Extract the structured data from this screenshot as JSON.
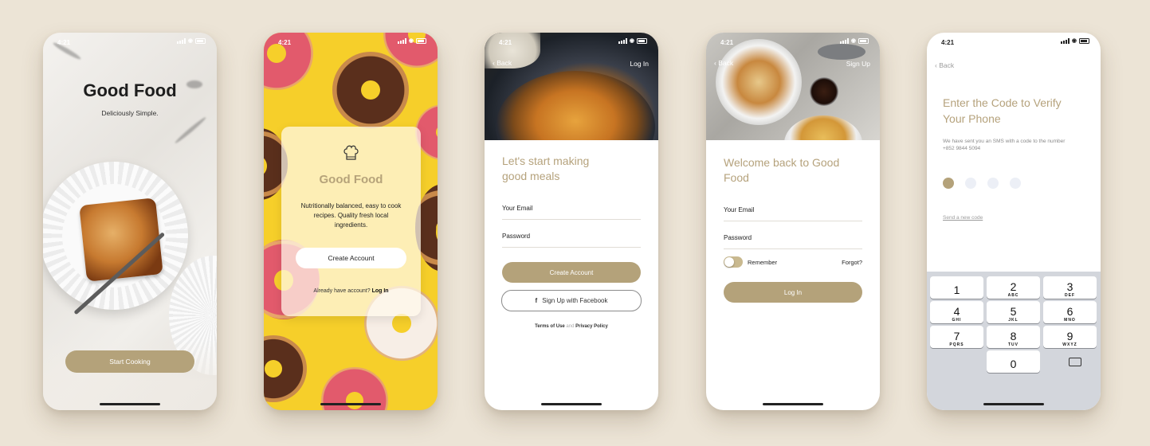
{
  "status": {
    "time": "4:21"
  },
  "screen1": {
    "title": "Good Food",
    "subtitle": "Deliciously Simple.",
    "cta": "Start Cooking"
  },
  "screen2": {
    "icon": "chef-hat-icon",
    "title": "Good Food",
    "description": "Nutritionally balanced, easy to cook recipes. Quality fresh local ingredients.",
    "create_account": "Create Account",
    "login_prompt": "Already have account?",
    "login_link": "Log In"
  },
  "screen3": {
    "back": "Back",
    "top_right": "Log In",
    "heading": "Let's start making good meals",
    "email_label": "Your Email",
    "password_label": "Password",
    "create_account": "Create Account",
    "facebook": "Sign Up with Facebook",
    "terms": "Terms of Use",
    "and": "and",
    "privacy": "Privacy Policy"
  },
  "screen4": {
    "back": "Back",
    "top_right": "Sign Up",
    "heading": "Welcome back to Good Food",
    "email_label": "Your Email",
    "password_label": "Password",
    "remember": "Remember",
    "forgot": "Forgot?",
    "login": "Log In"
  },
  "screen5": {
    "back": "Back",
    "heading": "Enter the Code to Verify Your Phone",
    "description": "We have sent you an SMS with a code to the number +852 9844 5094",
    "code_digits_filled": 1,
    "code_length": 4,
    "resend": "Send a new code",
    "keys": [
      {
        "num": "1",
        "letters": ""
      },
      {
        "num": "2",
        "letters": "ABC"
      },
      {
        "num": "3",
        "letters": "DEF"
      },
      {
        "num": "4",
        "letters": "GHI"
      },
      {
        "num": "5",
        "letters": "JKL"
      },
      {
        "num": "6",
        "letters": "MNO"
      },
      {
        "num": "7",
        "letters": "PQRS"
      },
      {
        "num": "8",
        "letters": "TUV"
      },
      {
        "num": "9",
        "letters": "WXYZ"
      },
      {
        "num": "0",
        "letters": ""
      }
    ]
  },
  "colors": {
    "accent": "#b4a27a",
    "background": "#ece4d6",
    "donut_yellow": "#f6cf2a"
  }
}
